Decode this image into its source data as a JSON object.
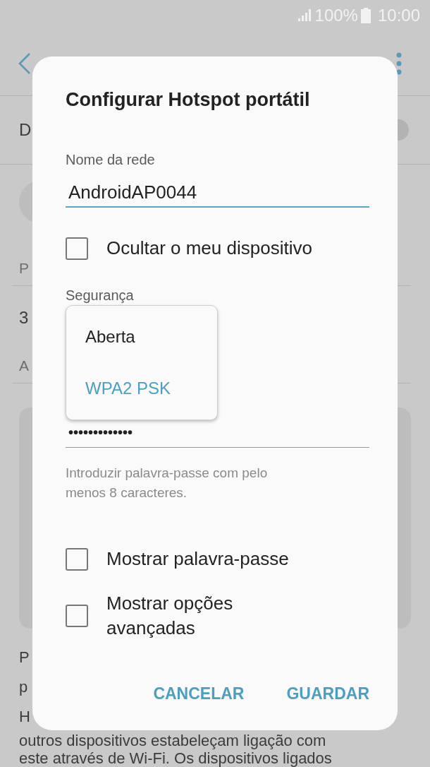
{
  "status_bar": {
    "battery": "100%",
    "time": "10:00"
  },
  "background": {
    "toggle_label": "D",
    "toggle_on": false,
    "section_1": "P",
    "row_1": "3",
    "section_2": "A",
    "paragraph_lines": [
      "P",
      "p",
      "H",
      "outros dispositivos estabeleçam ligação com",
      "este através de Wi-Fi. Os dispositivos ligados"
    ]
  },
  "dialog": {
    "title": "Configurar Hotspot portátil",
    "network_name": {
      "label": "Nome da rede",
      "value": "AndroidAP0044"
    },
    "hide_device": {
      "label": "Ocultar o meu dispositivo",
      "checked": false
    },
    "security": {
      "label": "Segurança",
      "options": [
        {
          "label": "Aberta",
          "selected": false
        },
        {
          "label": "WPA2 PSK",
          "selected": true
        }
      ]
    },
    "password": {
      "value": "•••••••••••••",
      "helper": "Introduzir palavra-passe com pelo menos 8 caracteres."
    },
    "checkboxes": [
      {
        "label": "Mostrar palavra-passe",
        "checked": false
      },
      {
        "label": "Mostrar opções avançadas",
        "checked": false
      }
    ],
    "buttons": [
      "CANCELAR",
      "GUARDAR"
    ]
  }
}
